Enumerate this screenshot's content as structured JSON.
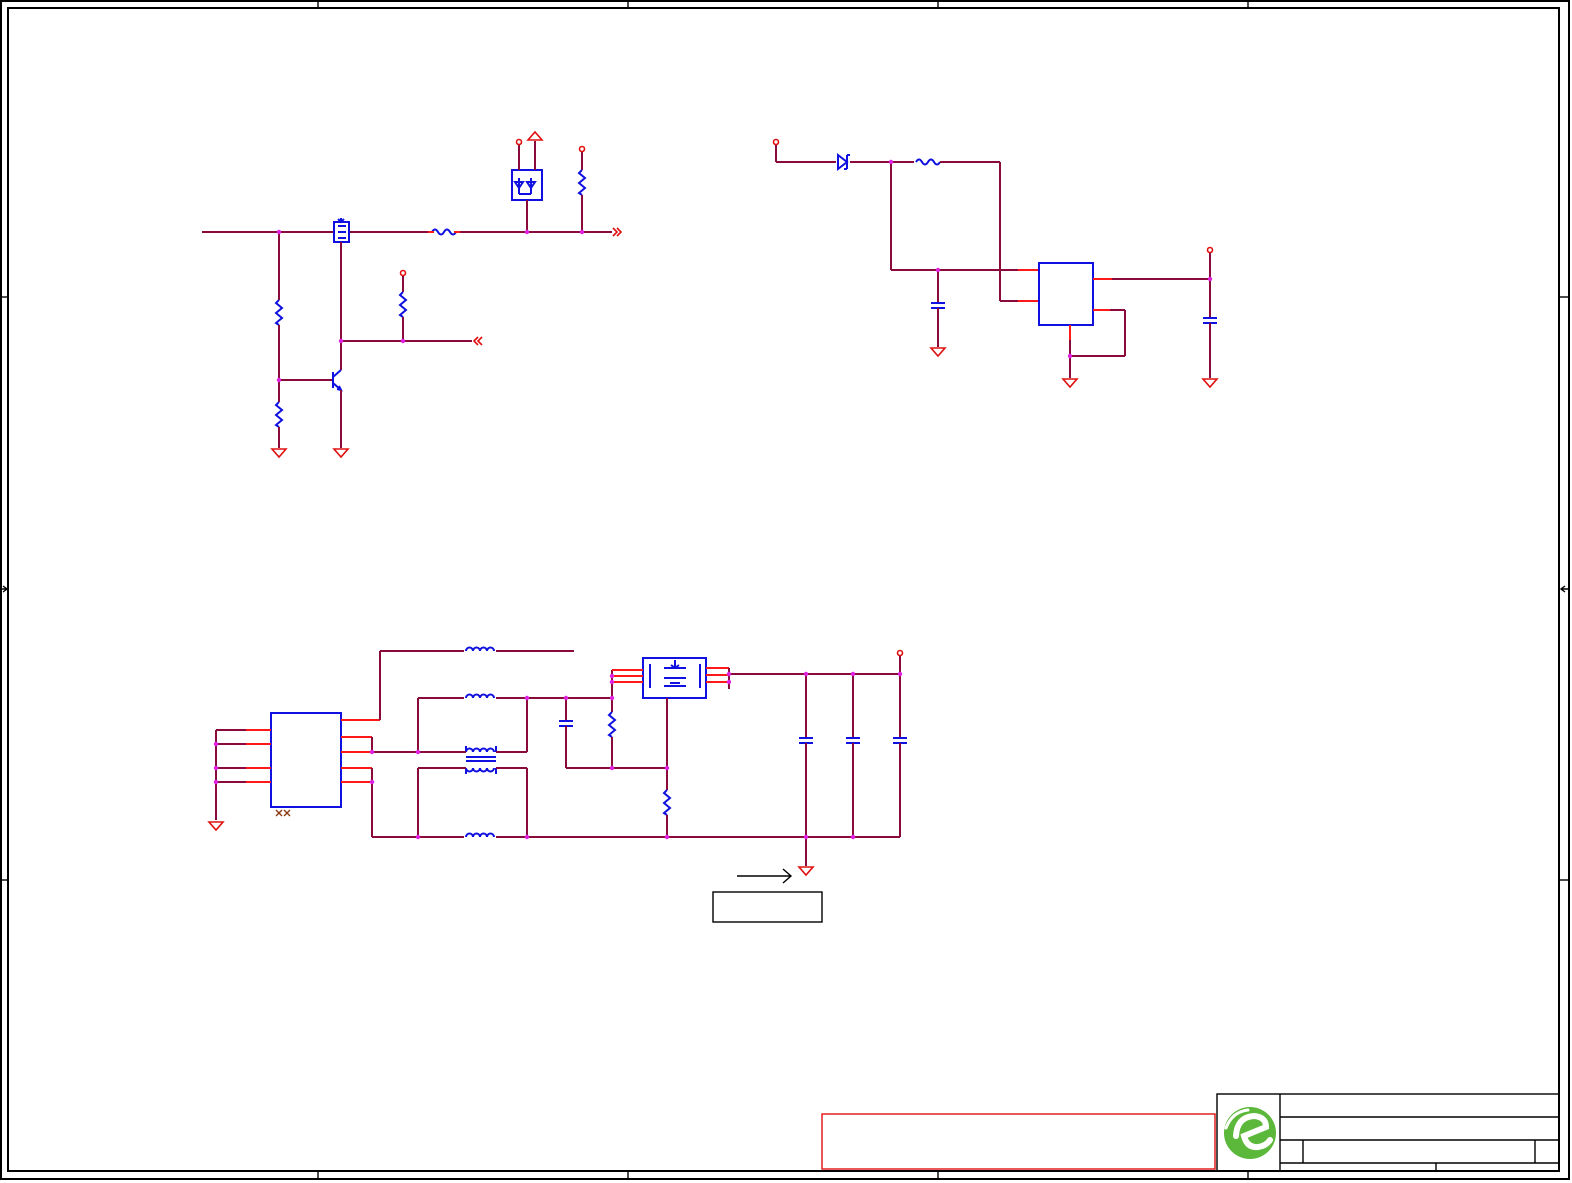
{
  "sheet": {
    "frame_color": "#000000",
    "wire_color": "#8b0a3c",
    "part_color": "#1010e0",
    "pin_color": "#ff1a1a",
    "junction_color": "#e020e0"
  },
  "title_block": {
    "logo": "green-e-logo-icon",
    "logo_color": "#5cb83a",
    "warning_box_color": "#e01010"
  },
  "circuits": [
    {
      "id": "high-side-switch",
      "parts": [
        "mosfet",
        "bjt",
        "resistor",
        "resistor",
        "resistor",
        "resistor",
        "ferrite-bead",
        "tvs-diode-array",
        "resistor"
      ]
    },
    {
      "id": "linear-regulator",
      "parts": [
        "schottky-diode",
        "ferrite-bead",
        "ic",
        "capacitor",
        "capacitor"
      ]
    },
    {
      "id": "usb-power-path",
      "parts": [
        "connector",
        "ferrite-bead",
        "ferrite-bead",
        "common-mode-choke",
        "ferrite-bead",
        "capacitor",
        "resistor",
        "dual-mosfet",
        "resistor",
        "capacitor",
        "capacitor",
        "capacitor"
      ]
    }
  ]
}
